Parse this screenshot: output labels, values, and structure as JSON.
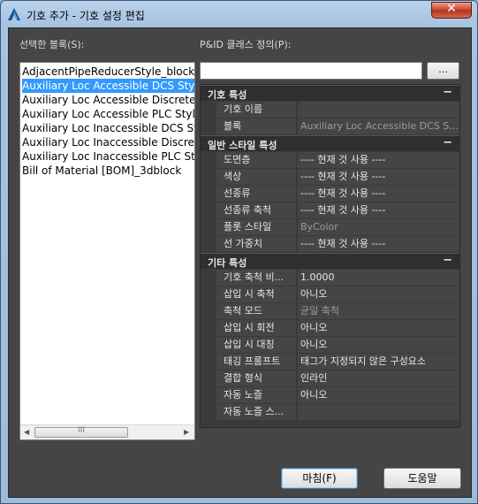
{
  "window": {
    "title": "기호 추가 - 기호 설정 편집",
    "close_glyph": "✕"
  },
  "left": {
    "label": "선택한 블록(S):",
    "items": [
      "AdjacentPipeReducerStyle_block",
      "Auxiliary Loc Accessible DCS Style",
      "Auxiliary Loc Accessible Discrete",
      "Auxiliary Loc Accessible PLC Style",
      "Auxiliary Loc Inaccessible DCS Style",
      "Auxiliary Loc Inaccessible Discrete",
      "Auxiliary Loc Inaccessible PLC Style",
      "Bill of Material [BOM]_3dblock"
    ],
    "selected_index": 1,
    "scroll_left": "◀",
    "scroll_right": "▶",
    "scroll_grip": "III"
  },
  "right": {
    "label": "P&ID 클래스 정의(P):",
    "class_value": "",
    "browse_label": "...",
    "categories": [
      {
        "name": "기호 특성",
        "toggle": "−",
        "rows": [
          {
            "name": "기호 이름",
            "value": ""
          },
          {
            "name": "블록",
            "value": "Auxiliary Loc Accessible DCS S...",
            "dim": true
          }
        ]
      },
      {
        "name": "일반 스타일 특성",
        "toggle": "−",
        "rows": [
          {
            "name": "도면층",
            "value": "---- 현재 것 사용 ----"
          },
          {
            "name": "색상",
            "value": "  ---- 현재 것 사용 ----"
          },
          {
            "name": "선종류",
            "value": "---- 현재 것 사용 ----"
          },
          {
            "name": "선종류 축척",
            "value": "---- 현재 것 사용 ----"
          },
          {
            "name": "플롯 스타일",
            "value": "ByColor",
            "dim": true
          },
          {
            "name": "선 가중치",
            "value": "---- 현재 것 사용 ----"
          }
        ]
      },
      {
        "name": "기타 특성",
        "toggle": "−",
        "rows": [
          {
            "name": "기호 축척 비...",
            "value": "1.0000"
          },
          {
            "name": "삽입 시 축척",
            "value": "아니오"
          },
          {
            "name": "축척 모드",
            "value": "균일 축척",
            "dim": true
          },
          {
            "name": "삽입 시 회전",
            "value": "아니오"
          },
          {
            "name": "삽입 시 대칭",
            "value": "아니오"
          },
          {
            "name": "태깅 프롬프트",
            "value": "태그가 지정되지 않은 구성요소"
          },
          {
            "name": "결합 형식",
            "value": "인라인"
          },
          {
            "name": "자동 노즐",
            "value": "아니오"
          },
          {
            "name": "자동 노즐 스...",
            "value": ""
          }
        ]
      }
    ]
  },
  "buttons": {
    "finish": "마침(F)",
    "help": "도움말"
  },
  "colors": {
    "selection": "#3399ff",
    "panel": "#454545",
    "category": "#2f2f2f"
  }
}
